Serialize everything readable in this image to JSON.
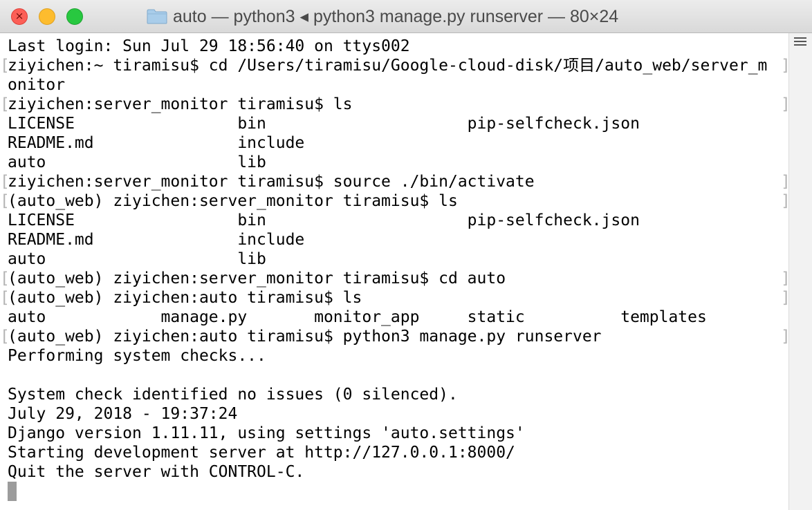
{
  "window": {
    "title": "auto — python3 ◂ python3 manage.py runserver — 80×24",
    "icon": "folder-icon",
    "controls": [
      "close-icon",
      "minimize-icon",
      "zoom-icon"
    ]
  },
  "terminal": {
    "lines": [
      {
        "text": "Last login: Sun Jul 29 18:56:40 on ttys002",
        "bracket_left": false,
        "bracket_right": false
      },
      {
        "text": "ziyichen:~ tiramisu$ cd /Users/tiramisu/Google-cloud-disk/项目/auto_web/server_m",
        "bracket_left": true,
        "bracket_right": true
      },
      {
        "text": "onitor",
        "bracket_left": false,
        "bracket_right": false
      },
      {
        "text": "ziyichen:server_monitor tiramisu$ ls",
        "bracket_left": true,
        "bracket_right": true
      },
      {
        "text": "LICENSE                 bin                     pip-selfcheck.json",
        "bracket_left": false,
        "bracket_right": false
      },
      {
        "text": "README.md               include",
        "bracket_left": false,
        "bracket_right": false
      },
      {
        "text": "auto                    lib",
        "bracket_left": false,
        "bracket_right": false
      },
      {
        "text": "ziyichen:server_monitor tiramisu$ source ./bin/activate",
        "bracket_left": true,
        "bracket_right": true
      },
      {
        "text": "(auto_web) ziyichen:server_monitor tiramisu$ ls",
        "bracket_left": true,
        "bracket_right": true
      },
      {
        "text": "LICENSE                 bin                     pip-selfcheck.json",
        "bracket_left": false,
        "bracket_right": false
      },
      {
        "text": "README.md               include",
        "bracket_left": false,
        "bracket_right": false
      },
      {
        "text": "auto                    lib",
        "bracket_left": false,
        "bracket_right": false
      },
      {
        "text": "(auto_web) ziyichen:server_monitor tiramisu$ cd auto",
        "bracket_left": true,
        "bracket_right": true
      },
      {
        "text": "(auto_web) ziyichen:auto tiramisu$ ls",
        "bracket_left": true,
        "bracket_right": true
      },
      {
        "text": "auto            manage.py       monitor_app     static          templates",
        "bracket_left": false,
        "bracket_right": false
      },
      {
        "text": "(auto_web) ziyichen:auto tiramisu$ python3 manage.py runserver",
        "bracket_left": true,
        "bracket_right": true
      },
      {
        "text": "Performing system checks...",
        "bracket_left": false,
        "bracket_right": false
      },
      {
        "text": "",
        "bracket_left": false,
        "bracket_right": false
      },
      {
        "text": "System check identified no issues (0 silenced).",
        "bracket_left": false,
        "bracket_right": false
      },
      {
        "text": "July 29, 2018 - 19:37:24",
        "bracket_left": false,
        "bracket_right": false
      },
      {
        "text": "Django version 1.11.11, using settings 'auto.settings'",
        "bracket_left": false,
        "bracket_right": false
      },
      {
        "text": "Starting development server at http://127.0.0.1:8000/",
        "bracket_left": false,
        "bracket_right": false
      },
      {
        "text": "Quit the server with CONTROL-C.",
        "bracket_left": false,
        "bracket_right": false
      }
    ],
    "cursor_icon": "block-cursor",
    "bracket_left_char": "[",
    "bracket_right_char": "]"
  },
  "scrollbar": {
    "icon": "menu-lines-icon"
  },
  "colors": {
    "close": "#fc5f57",
    "minimize": "#fdbc2e",
    "zoom": "#28c840",
    "text": "#000000",
    "background": "#ffffff"
  }
}
